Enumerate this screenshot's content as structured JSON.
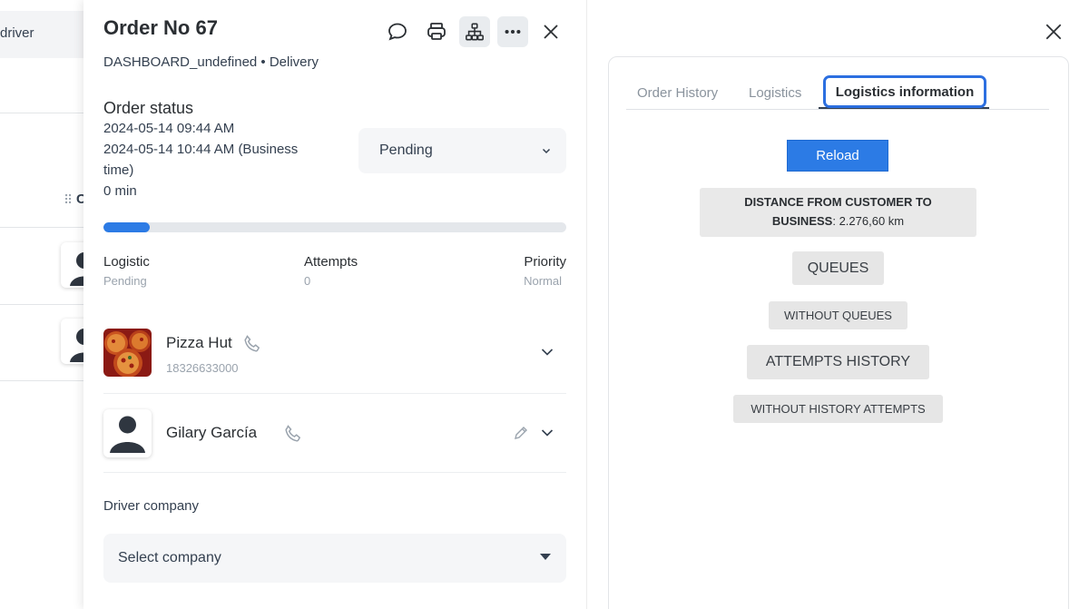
{
  "background": {
    "header_text": "driver",
    "column_label": "C"
  },
  "order": {
    "title": "Order No 67",
    "subtitle": "DASHBOARD_undefined • Delivery",
    "icons": [
      "chat-icon",
      "printer-icon",
      "sitemap-icon",
      "more-icon",
      "close-icon"
    ]
  },
  "status": {
    "title": "Order status",
    "created": "2024-05-14 09:44 AM",
    "business_time_1": "2024-05-14 10:44 AM (Business",
    "business_time_2": "time)",
    "elapsed": "0 min",
    "selected": "Pending",
    "progress_percent": 10
  },
  "meta": {
    "logistic_label": "Logistic",
    "logistic_value": "Pending",
    "attempts_label": "Attempts",
    "attempts_value": "0",
    "priority_label": "Priority",
    "priority_value": "Normal"
  },
  "business": {
    "name": "Pizza Hut",
    "phone": "18326633000"
  },
  "customer": {
    "name": "Gilary García"
  },
  "driver_company": {
    "label": "Driver company",
    "placeholder": "Select company"
  },
  "right": {
    "tabs": {
      "order_history": "Order History",
      "logistics": "Logistics",
      "logistics_information": "Logistics information"
    },
    "reload": "Reload",
    "distance_label_1": "DISTANCE FROM CUSTOMER TO",
    "distance_label_2": "BUSINESS",
    "distance_value": ": 2.276,60 km",
    "queues": "QUEUES",
    "without_queues": "WITHOUT QUEUES",
    "attempts_history": "ATTEMPTS HISTORY",
    "without_history_attempts": "WITHOUT HISTORY ATTEMPTS"
  },
  "colors": {
    "accent": "#2c7be5",
    "focus_ring": "#2c6fe0"
  }
}
